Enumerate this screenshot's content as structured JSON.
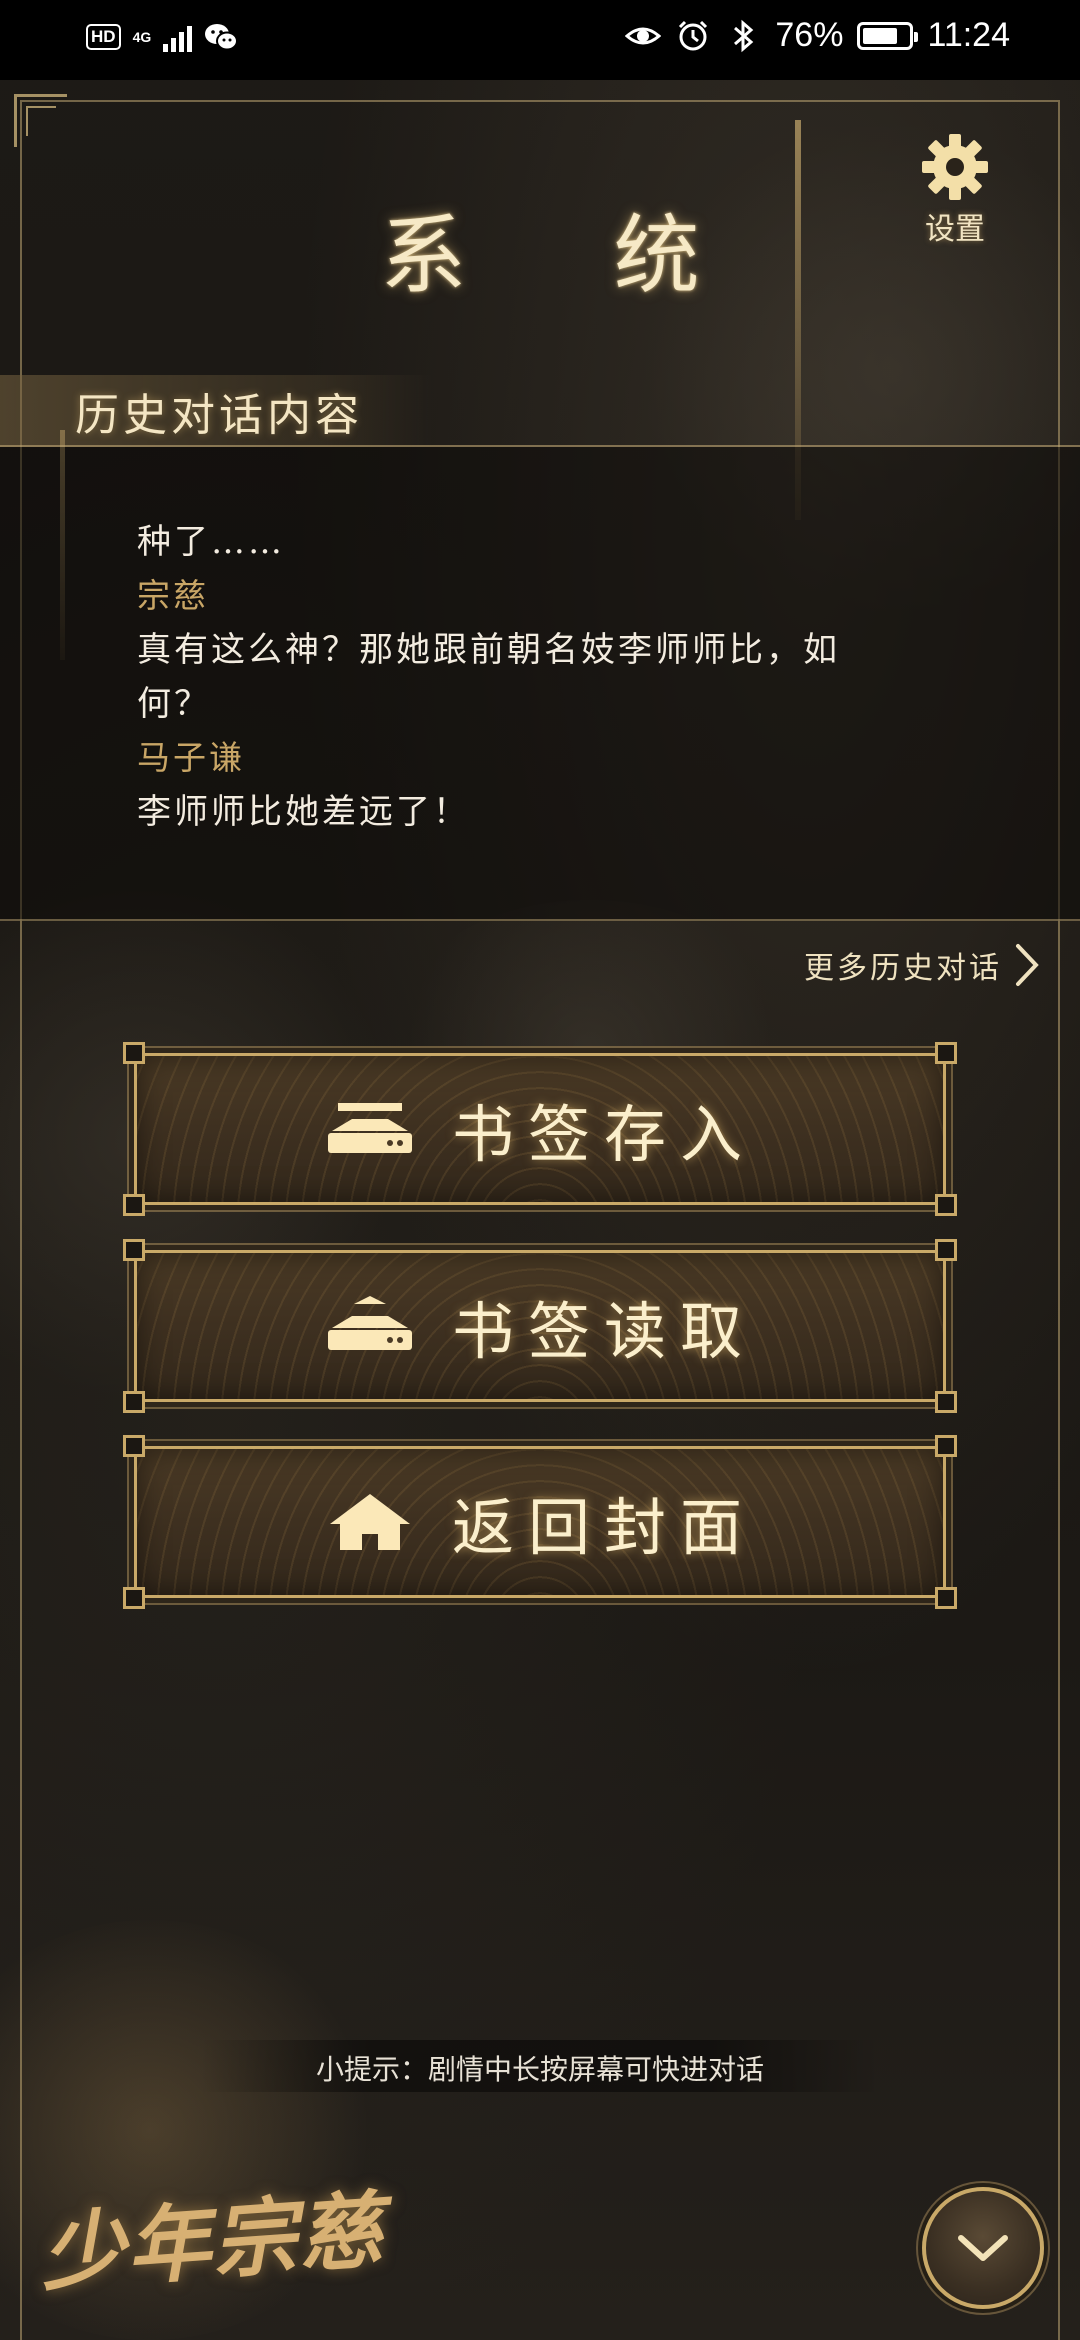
{
  "status_bar": {
    "hd_badge": "HD",
    "network": "4G",
    "battery": "76%",
    "battery_level": 0.76,
    "time": "11:24"
  },
  "header": {
    "title": "系 统",
    "settings_label": "设置"
  },
  "history": {
    "section_title": "历史对话内容",
    "lines": [
      {
        "type": "text",
        "text": "种了……"
      },
      {
        "type": "speaker",
        "text": "宗慈"
      },
      {
        "type": "text",
        "text": "真有这么神？那她跟前朝名妓李师师比，如"
      },
      {
        "type": "text",
        "text": "何？"
      },
      {
        "type": "speaker",
        "text": "马子谦"
      },
      {
        "type": "text",
        "text": "李师师比她差远了！"
      }
    ],
    "more_label": "更多历史对话"
  },
  "menu": {
    "save_label": "书签存入",
    "load_label": "书签读取",
    "home_label": "返回封面"
  },
  "tip": "小提示：剧情中长按屏幕可快进对话",
  "logo_text": "少年宗慈",
  "colors": {
    "gold": "#c9a968",
    "title_text": "#f6e9c6",
    "speaker": "#c9a666",
    "dialogue": "#f3ece0",
    "background": "#1c1915"
  },
  "icons": [
    "eye-icon",
    "alarm-icon",
    "bluetooth-icon",
    "battery-icon",
    "gear-icon",
    "chevron-right-icon",
    "bookmark-save-icon",
    "bookmark-load-icon",
    "home-icon",
    "chevron-down-icon"
  ]
}
